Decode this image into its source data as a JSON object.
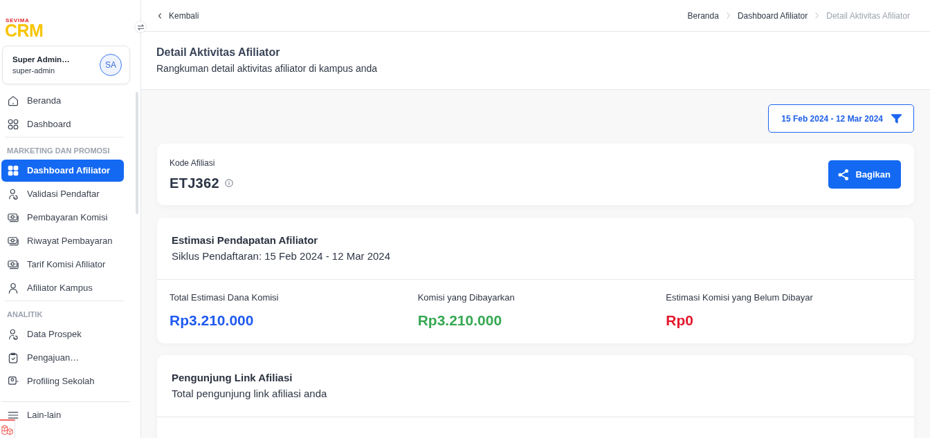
{
  "sidebar": {
    "logo": {
      "brand": "SEVIMA",
      "product": "CRM"
    },
    "user": {
      "name": "Super Admin…",
      "role": "super-admin",
      "initials": "SA"
    },
    "sections": [
      {
        "items": [
          {
            "label": "Beranda",
            "selected": false
          },
          {
            "label": "Dashboard",
            "selected": false
          }
        ]
      },
      {
        "heading": "MARKETING DAN PROMOSI",
        "items": [
          {
            "label": "Dashboard Afiliator",
            "selected": true
          },
          {
            "label": "Validasi Pendaftar",
            "selected": false
          },
          {
            "label": "Pembayaran Komisi",
            "selected": false
          },
          {
            "label": "Riwayat Pembayaran",
            "selected": false
          },
          {
            "label": "Tarif Komisi Afiliator",
            "selected": false
          },
          {
            "label": "Afiliator Kampus",
            "selected": false
          }
        ]
      },
      {
        "heading": "ANALITIK",
        "items": [
          {
            "label": "Data Prospek",
            "selected": false
          },
          {
            "label": "Pengajuan…",
            "selected": false
          },
          {
            "label": "Profiling Sekolah",
            "selected": false
          }
        ]
      }
    ],
    "footer_item": {
      "label": "Lain-lain"
    }
  },
  "topbar": {
    "back_link": "Kembali",
    "breadcrumbs": [
      {
        "label": "Beranda",
        "current": false
      },
      {
        "label": "Dashboard Afiliator",
        "current": false
      },
      {
        "label": "Detail Aktivitas Afiliator",
        "current": true
      }
    ]
  },
  "page_header": {
    "title": "Detail Aktivitas Afiliator",
    "subtitle": "Rangkuman detail aktivitas afiliator di kampus anda"
  },
  "date_filter": {
    "label": "15 Feb 2024 - 12 Mar 2024"
  },
  "affiliate_card": {
    "label": "Kode Afiliasi",
    "code": "ETJ362",
    "share_button": "Bagikan"
  },
  "earnings_card": {
    "title": "Estimasi Pendapatan Afiliator",
    "subtitle": "Siklus Pendaftaran: 15 Feb 2024 - 12 Mar 2024",
    "metrics": [
      {
        "label": "Total Estimasi Dana Komisi",
        "value": "Rp3.210.000",
        "color": "#1f5af0"
      },
      {
        "label": "Komisi yang Dibayarkan",
        "value": "Rp3.210.000",
        "color": "#36a852"
      },
      {
        "label": "Estimasi Komisi yang Belum Dibayar",
        "value": "Rp0",
        "color": "#e3182d"
      }
    ]
  },
  "visitors_card": {
    "title": "Pengunjung Link Afiliasi",
    "subtitle": "Total pengunjung link afiliasi anda"
  }
}
